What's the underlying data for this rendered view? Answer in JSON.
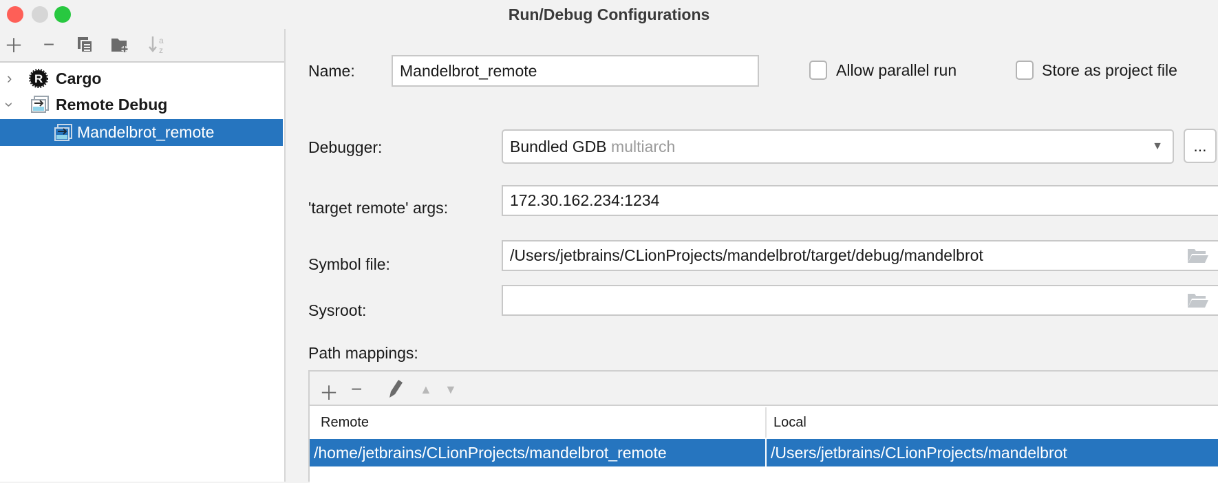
{
  "window": {
    "title": "Run/Debug Configurations"
  },
  "toolbar": {
    "icons": [
      "add-icon",
      "remove-icon",
      "copy-icon",
      "new-folder-icon",
      "sort-icon"
    ]
  },
  "tree": {
    "items": [
      {
        "label": "Cargo",
        "expanded": false
      },
      {
        "label": "Remote Debug",
        "expanded": true
      },
      {
        "label": "Mandelbrot_remote",
        "selected": true
      }
    ]
  },
  "form": {
    "name_label": "Name:",
    "name_value": "Mandelbrot_remote",
    "allow_parallel_label": "Allow parallel run",
    "allow_parallel_checked": false,
    "store_project_label": "Store as project file",
    "store_project_checked": false,
    "debugger_label": "Debugger:",
    "debugger_value": "Bundled GDB",
    "debugger_hint": "multiarch",
    "more_label": "...",
    "target_label": "'target remote' args:",
    "target_value": "172.30.162.234:1234",
    "symbol_label": "Symbol file:",
    "symbol_value": "/Users/jetbrains/CLionProjects/mandelbrot/target/debug/mandelbrot",
    "sysroot_label": "Sysroot:",
    "sysroot_value": "",
    "path_mappings_label": "Path mappings:"
  },
  "mappings": {
    "columns": [
      "Remote",
      "Local"
    ],
    "rows": [
      {
        "remote": "/home/jetbrains/CLionProjects/mandelbrot_remote",
        "local": "/Users/jetbrains/CLionProjects/mandelbrot"
      }
    ]
  },
  "colors": {
    "selection": "#2675bf",
    "close": "#fe5f57",
    "minimize": "#d0d0d0",
    "zoom": "#28c840"
  }
}
